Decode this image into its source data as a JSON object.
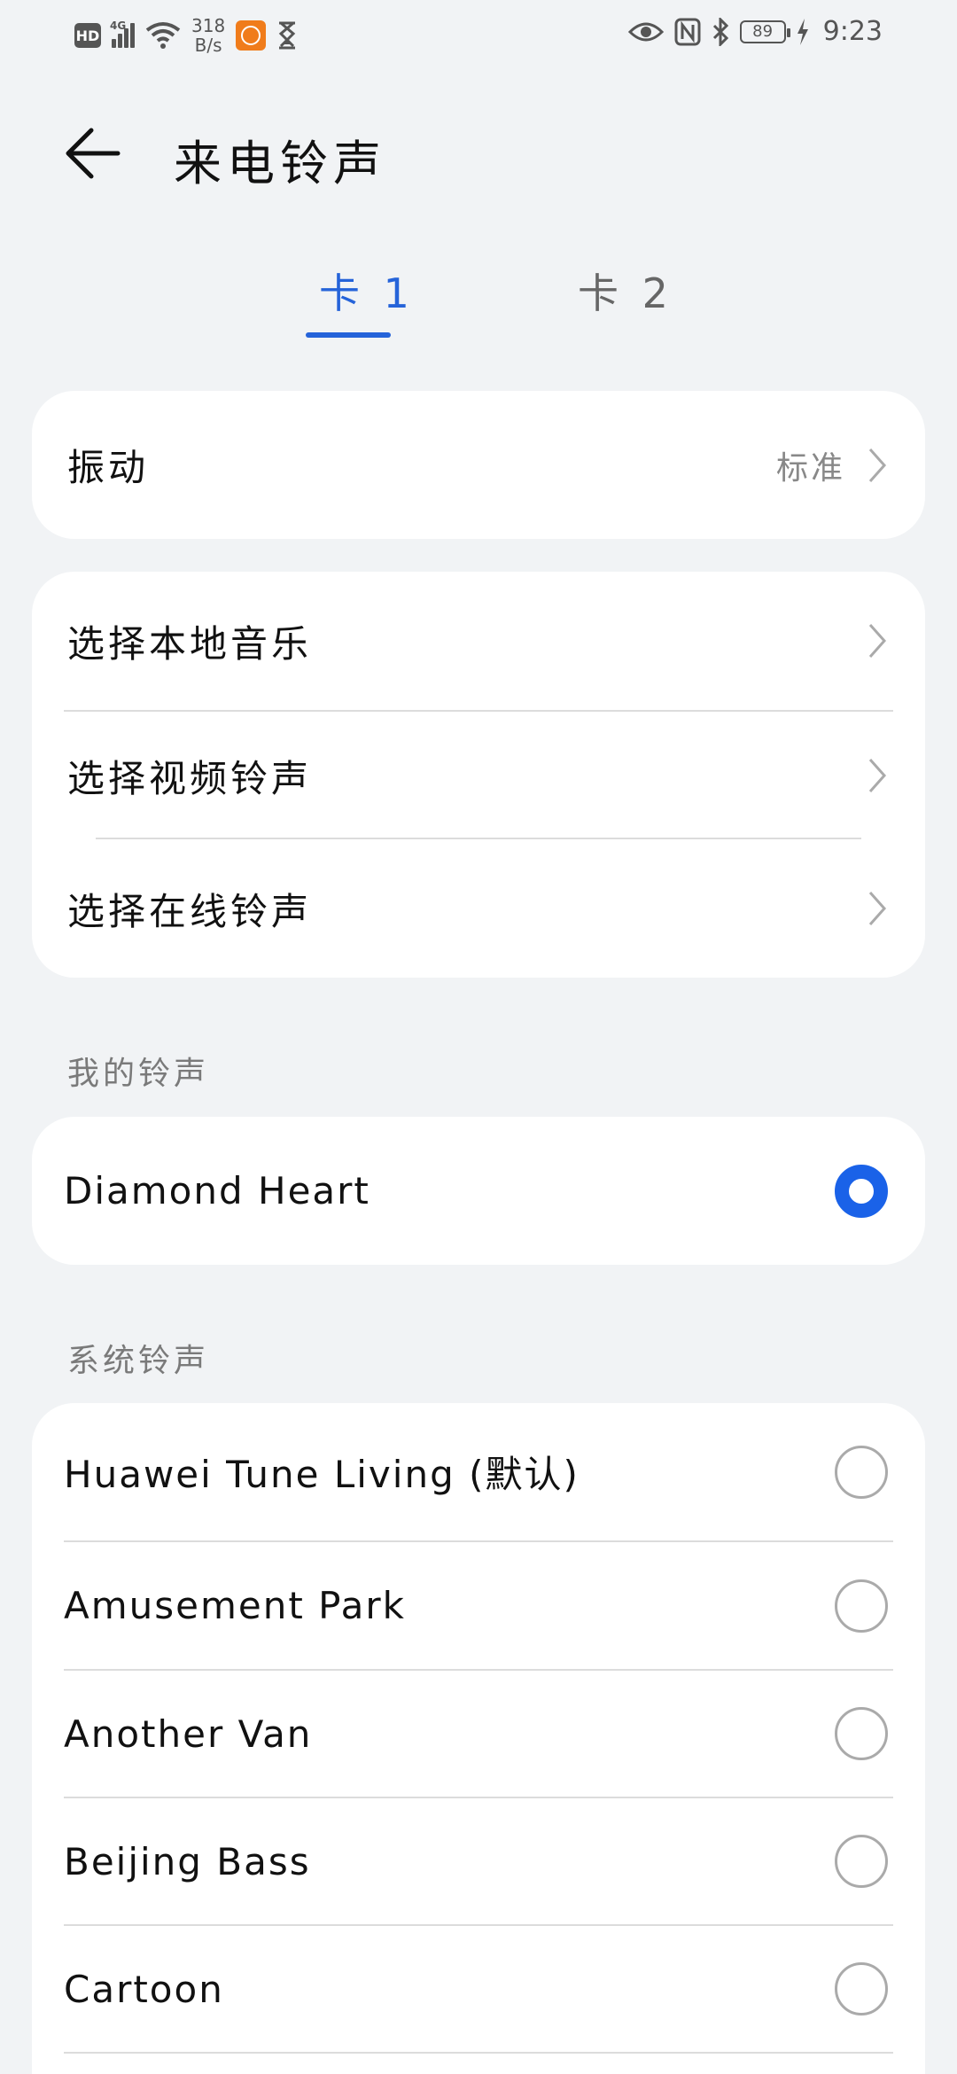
{
  "status_bar": {
    "hd": "HD",
    "network": "4G",
    "speed_value": "318",
    "speed_unit": "B/s",
    "battery": "89",
    "time": "9:23"
  },
  "header": {
    "title": "来电铃声"
  },
  "tabs": [
    {
      "label": "卡 1",
      "selected": true
    },
    {
      "label": "卡 2",
      "selected": false
    }
  ],
  "vibration": {
    "label": "振动",
    "value": "标准"
  },
  "source_options": [
    {
      "label": "选择本地音乐"
    },
    {
      "label": "选择视频铃声"
    },
    {
      "label": "选择在线铃声"
    }
  ],
  "my_ringtones": {
    "title": "我的铃声",
    "items": [
      {
        "label": "Diamond Heart",
        "selected": true
      }
    ]
  },
  "system_ringtones": {
    "title": "系统铃声",
    "items": [
      {
        "label": "Huawei Tune Living (默认)",
        "selected": false
      },
      {
        "label": "Amusement Park",
        "selected": false
      },
      {
        "label": "Another Van",
        "selected": false
      },
      {
        "label": "Beijing Bass",
        "selected": false
      },
      {
        "label": "Cartoon",
        "selected": false
      }
    ]
  },
  "colors": {
    "accent": "#1a62e8",
    "background": "#f1f3f5",
    "card": "#ffffff"
  }
}
